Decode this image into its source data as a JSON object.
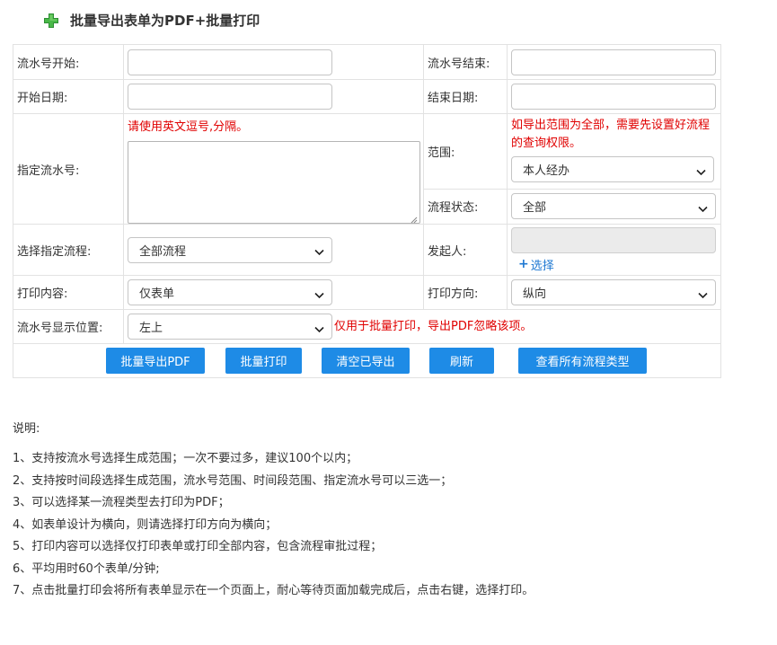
{
  "header": {
    "title": "批量导出表单为PDF+批量打印",
    "icon": "plus-icon",
    "icon_color": "#3cb44a"
  },
  "form": {
    "serial_start_label": "流水号开始:",
    "serial_end_label": "流水号结束:",
    "start_date_label": "开始日期:",
    "end_date_label": "结束日期:",
    "specify_serial_label": "指定流水号:",
    "specify_serial_hint": "请使用英文逗号,分隔。",
    "scope_label": "范围:",
    "scope_hint": "如导出范围为全部，需要先设置好流程的查询权限。",
    "scope_value": "本人经办",
    "flow_status_label": "流程状态:",
    "flow_status_value": "全部",
    "select_flow_label": "选择指定流程:",
    "select_flow_value": "全部流程",
    "initiator_label": "发起人:",
    "initiator_choose": "选择",
    "print_content_label": "打印内容:",
    "print_content_value": "仅表单",
    "print_direction_label": "打印方向:",
    "print_direction_value": "纵向",
    "serial_position_label": "流水号显示位置:",
    "serial_position_value": "左上",
    "serial_position_hint": "仅用于批量打印，导出PDF忽略该项。"
  },
  "buttons": {
    "batch_export_pdf": "批量导出PDF",
    "batch_print": "批量打印",
    "clear_exported": "清空已导出",
    "refresh": "刷新",
    "view_all_flow_types": "查看所有流程类型"
  },
  "notes": {
    "title": "说明:",
    "items": [
      "1、支持按流水号选择生成范围；一次不要过多，建议100个以内；",
      "2、支持按时间段选择生成范围，流水号范围、时间段范围、指定流水号可以三选一；",
      "3、可以选择某一流程类型去打印为PDF；",
      "4、如表单设计为横向，则请选择打印方向为横向；",
      "5、打印内容可以选择仅打印表单或打印全部内容，包含流程审批过程；",
      "6、平均用时60个表单/分钟;",
      "7、点击批量打印会将所有表单显示在一个页面上，耐心等待页面加载完成后，点击右键，选择打印。"
    ]
  },
  "colors": {
    "button_blue": "#1e8be6",
    "hint_red": "#e00000",
    "link_blue": "#1e78d2"
  }
}
